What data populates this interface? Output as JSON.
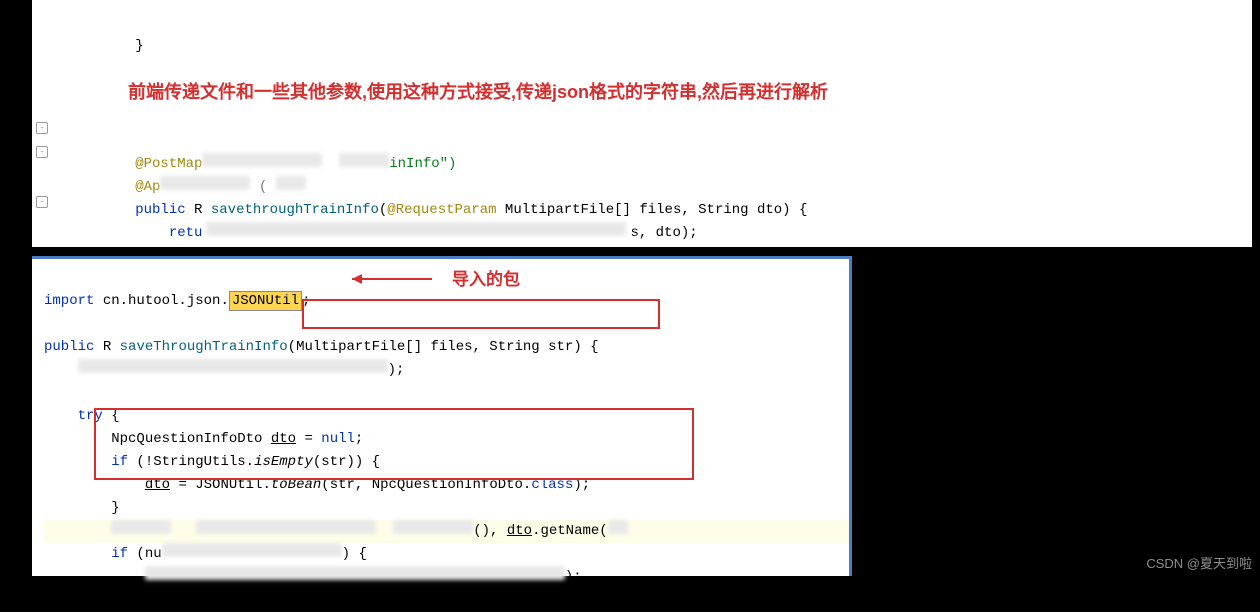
{
  "annotations": {
    "top_comment": "前端传递文件和一些其他参数,使用这种方式接受,传递json格式的字符串,然后再进行解析",
    "import_label": "导入的包"
  },
  "top_code": {
    "brace_close": "}",
    "post_mapping_pre": "@PostMap",
    "post_mapping_suffix": "inInfo\")",
    "api_anno": "@Ap",
    "public_kw": "public",
    "return_type": "R",
    "method_name": "savethroughTrainInfo",
    "param_anno": "@RequestParam",
    "param_rest": " MultipartFile[] files, String dto) {",
    "return_kw": "retu",
    "return_suffix": "s, dto);"
  },
  "bottom_code": {
    "import_kw": "import",
    "import_pkg": " cn.hutool.json.",
    "import_class": "JSONUtil",
    "public_kw": "public",
    "return_type": "R",
    "method_name": "saveThroughTrainInfo",
    "params": "(MultipartFile[] files, String str)",
    "open_brace": " {",
    "line_end_suffix": ");",
    "try_kw": "try",
    "try_open": " {",
    "dto_line_pre": "NpcQuestionInfoDto ",
    "dto_var": "dto",
    "dto_assign": " = ",
    "null_kw": "null",
    "semicolon": ";",
    "if_kw": "if",
    "if_cond_pre": " (!StringUtils.",
    "isEmpty": "isEmpty",
    "if_cond_post": "(str)) {",
    "dto_assign_line_pre": "dto",
    "dto_eq": " = JSONUtil.",
    "toBean": "toBean",
    "toBean_args": "(str, NpcQuestionInfoDto.",
    "class_kw": "class",
    "toBean_end": ");",
    "if_close": "}",
    "smudge_line_suffix_pre": "(), ",
    "smudge_dto": "dto",
    "getName": ".getName(",
    "if_null_pre": "if",
    "if_null_mid": " (nu",
    "smudge_end": ") {",
    "final_smudge_end": ");"
  },
  "watermark": "CSDN @夏天到啦"
}
